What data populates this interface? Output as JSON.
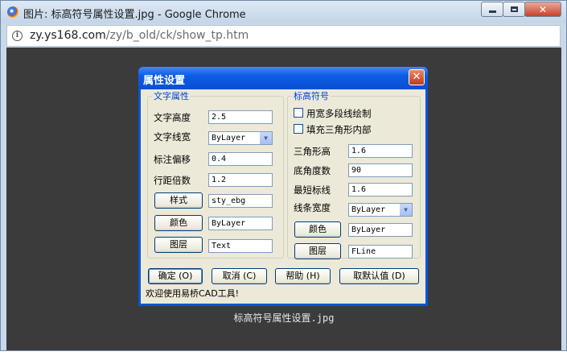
{
  "browser": {
    "window_title": "图片: 标高符号属性设置.jpg - Google Chrome",
    "url_host": "zy.ys168.com",
    "url_path": "/zy/b_old/ck/show_tp.htm"
  },
  "viewer": {
    "caption": "标高符号属性设置.jpg"
  },
  "dialog": {
    "title": "属性设置",
    "text_group": {
      "legend": "文字属性",
      "height_label": "文字高度",
      "height_value": "2.5",
      "lineweight_label": "文字线宽",
      "lineweight_value": "ByLayer",
      "offset_label": "标注偏移",
      "offset_value": "0.4",
      "spacing_label": "行距倍数",
      "spacing_value": "1.2",
      "style_button": "样式",
      "style_value": "sty_ebg",
      "color_button": "颜色",
      "color_value": "ByLayer",
      "layer_button": "图层",
      "layer_value": "Text"
    },
    "symbol_group": {
      "legend": "标高符号",
      "polyline_checkbox": "用宽多段线绘制",
      "polyline_checked": false,
      "fill_checkbox": "填充三角形内部",
      "fill_checked": false,
      "tri_height_label": "三角形高",
      "tri_height_value": "1.6",
      "base_angle_label": "底角度数",
      "base_angle_value": "90",
      "min_line_label": "最短标线",
      "min_line_value": "1.6",
      "line_width_label": "线条宽度",
      "line_width_value": "ByLayer",
      "color_button": "颜色",
      "color_value": "ByLayer",
      "layer_button": "图层",
      "layer_value": "FLine"
    },
    "buttons": {
      "ok": "确定 (O)",
      "cancel": "取消 (C)",
      "help": "帮助 (H)",
      "defaults": "取默认值 (D)"
    },
    "status": "欢迎使用易桥CAD工具!"
  }
}
